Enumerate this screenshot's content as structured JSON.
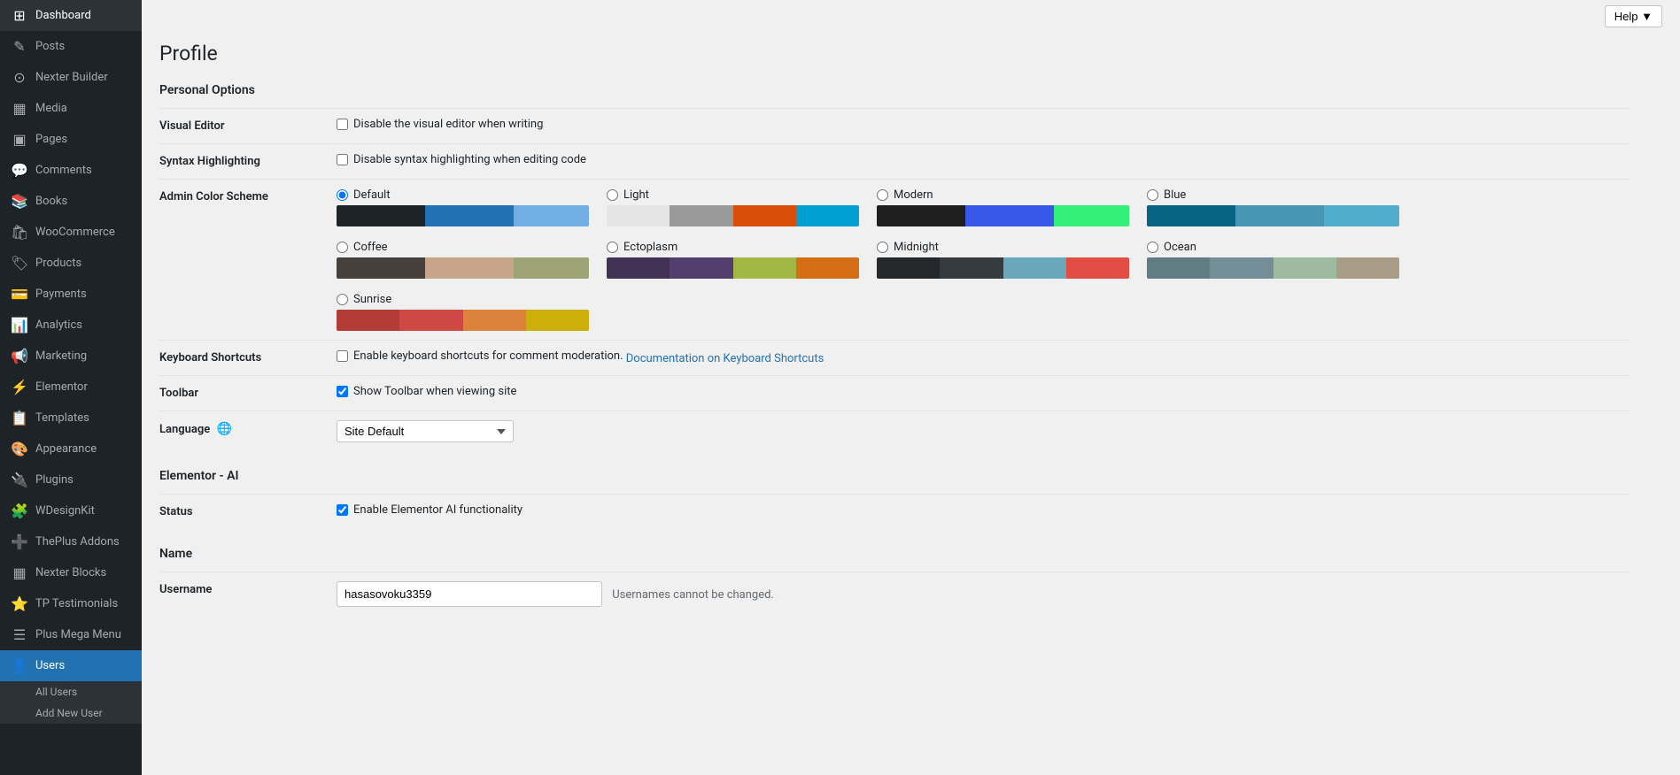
{
  "topbar": {
    "help_label": "Help ▼"
  },
  "page": {
    "title": "Profile",
    "personal_options_title": "Personal Options"
  },
  "sidebar": {
    "items": [
      {
        "id": "dashboard",
        "icon": "⊞",
        "label": "Dashboard"
      },
      {
        "id": "posts",
        "icon": "✎",
        "label": "Posts"
      },
      {
        "id": "nexter-builder",
        "icon": "⊙",
        "label": "Nexter Builder"
      },
      {
        "id": "media",
        "icon": "▦",
        "label": "Media"
      },
      {
        "id": "pages",
        "icon": "▣",
        "label": "Pages"
      },
      {
        "id": "comments",
        "icon": "💬",
        "label": "Comments"
      },
      {
        "id": "books",
        "icon": "📚",
        "label": "Books"
      },
      {
        "id": "woocommerce",
        "icon": "🛍",
        "label": "WooCommerce"
      },
      {
        "id": "products",
        "icon": "🏷",
        "label": "Products"
      },
      {
        "id": "payments",
        "icon": "💳",
        "label": "Payments"
      },
      {
        "id": "analytics",
        "icon": "📊",
        "label": "Analytics"
      },
      {
        "id": "marketing",
        "icon": "📢",
        "label": "Marketing"
      },
      {
        "id": "elementor",
        "icon": "⚡",
        "label": "Elementor"
      },
      {
        "id": "templates",
        "icon": "📋",
        "label": "Templates"
      },
      {
        "id": "appearance",
        "icon": "🎨",
        "label": "Appearance"
      },
      {
        "id": "plugins",
        "icon": "🔌",
        "label": "Plugins"
      },
      {
        "id": "wdesignkit",
        "icon": "🧩",
        "label": "WDesignKit"
      },
      {
        "id": "theplus-addons",
        "icon": "➕",
        "label": "ThePlus Addons"
      },
      {
        "id": "nexter-blocks",
        "icon": "▦",
        "label": "Nexter Blocks"
      },
      {
        "id": "tp-testimonials",
        "icon": "⭐",
        "label": "TP Testimonials"
      },
      {
        "id": "plus-mega-menu",
        "icon": "☰",
        "label": "Plus Mega Menu"
      },
      {
        "id": "users",
        "icon": "👤",
        "label": "Users",
        "active": true
      }
    ],
    "users_submenu": [
      {
        "id": "all-users",
        "label": "All Users"
      },
      {
        "id": "add-new-user",
        "label": "Add New User"
      }
    ]
  },
  "form": {
    "visual_editor_label": "Visual Editor",
    "visual_editor_checkbox": "Disable the visual editor when writing",
    "syntax_highlighting_label": "Syntax Highlighting",
    "syntax_highlighting_checkbox": "Disable syntax highlighting when editing code",
    "admin_color_scheme_label": "Admin Color Scheme",
    "keyboard_shortcuts_label": "Keyboard Shortcuts",
    "keyboard_shortcuts_checkbox": "Enable keyboard shortcuts for comment moderation.",
    "keyboard_shortcuts_link": "Documentation on Keyboard Shortcuts",
    "toolbar_label": "Toolbar",
    "toolbar_checkbox": "Show Toolbar when viewing site",
    "language_label": "Language",
    "language_icon": "🌐",
    "language_options": [
      {
        "value": "site-default",
        "label": "Site Default"
      }
    ],
    "language_selected": "Site Default"
  },
  "elementor_ai": {
    "section_title": "Elementor - AI",
    "status_label": "Status",
    "status_checkbox": "Enable Elementor AI functionality"
  },
  "name_section": {
    "section_title": "Name",
    "username_label": "Username",
    "username_value": "hasasovoku3359",
    "username_note": "Usernames cannot be changed."
  },
  "color_schemes": [
    {
      "id": "default",
      "label": "Default",
      "selected": true,
      "colors": [
        "#1d2327",
        "#2271b1",
        "#72aee6"
      ]
    },
    {
      "id": "light",
      "label": "Light",
      "selected": false,
      "colors": [
        "#e5e5e5",
        "#999",
        "#d64e07",
        "#00a0d2"
      ]
    },
    {
      "id": "modern",
      "label": "Modern",
      "selected": false,
      "colors": [
        "#1e1e1e",
        "#3858e9",
        "#33f078"
      ]
    },
    {
      "id": "blue",
      "label": "Blue",
      "selected": false,
      "colors": [
        "#096484",
        "#4796b3",
        "#52accc"
      ]
    },
    {
      "id": "coffee",
      "label": "Coffee",
      "selected": false,
      "colors": [
        "#46403c",
        "#c7a589",
        "#9ea476"
      ]
    },
    {
      "id": "ectoplasm",
      "label": "Ectoplasm",
      "selected": false,
      "colors": [
        "#413256",
        "#523f6d",
        "#a3b745",
        "#d46f15"
      ]
    },
    {
      "id": "midnight",
      "label": "Midnight",
      "selected": false,
      "colors": [
        "#25282b",
        "#363b3f",
        "#69a8bb",
        "#e14d43"
      ]
    },
    {
      "id": "ocean",
      "label": "Ocean",
      "selected": false,
      "colors": [
        "#627c83",
        "#738e96",
        "#9ebaa0",
        "#aa9d88"
      ]
    },
    {
      "id": "sunrise",
      "label": "Sunrise",
      "selected": false,
      "colors": [
        "#b43c38",
        "#cf4944",
        "#dd823b",
        "#ccaf0b"
      ]
    }
  ]
}
